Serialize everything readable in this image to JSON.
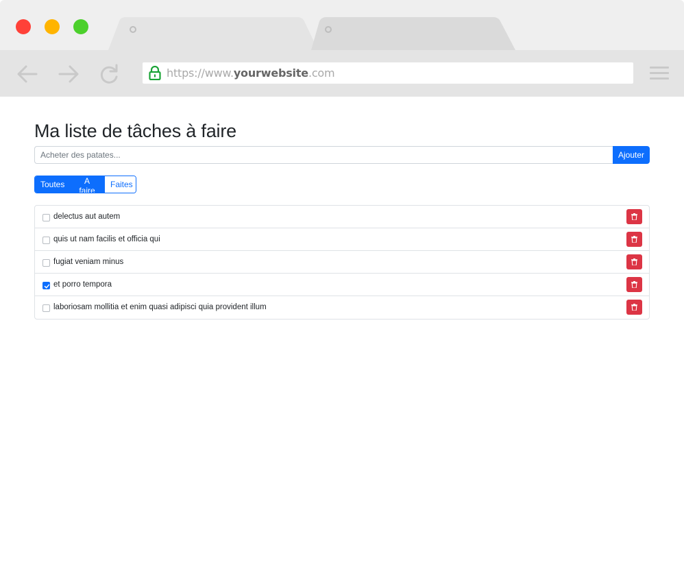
{
  "browser": {
    "url_scheme": "https://www.",
    "url_domain": "yourwebsite",
    "url_tld": ".com"
  },
  "page": {
    "title": "Ma liste de tâches à faire"
  },
  "add_form": {
    "placeholder": "Acheter des patates...",
    "value": "",
    "button_label": "Ajouter"
  },
  "filters": [
    {
      "label": "Toutes",
      "active": true
    },
    {
      "label": "A faire",
      "active": true
    },
    {
      "label": "Faites",
      "active": false
    }
  ],
  "tasks": [
    {
      "label": "delectus aut autem",
      "done": false
    },
    {
      "label": "quis ut nam facilis et officia qui",
      "done": false
    },
    {
      "label": "fugiat veniam minus",
      "done": false
    },
    {
      "label": "et porro tempora",
      "done": true
    },
    {
      "label": "laboriosam mollitia et enim quasi adipisci quia provident illum",
      "done": false
    }
  ],
  "icons": {
    "lock": "lock-icon",
    "back": "arrow-left-icon",
    "forward": "arrow-right-icon",
    "reload": "reload-icon",
    "menu": "hamburger-menu-icon",
    "delete": "trash-icon",
    "check": "check-icon"
  },
  "colors": {
    "primary": "#0d6efd",
    "danger": "#dc3545",
    "lock_green": "#1aa336"
  }
}
